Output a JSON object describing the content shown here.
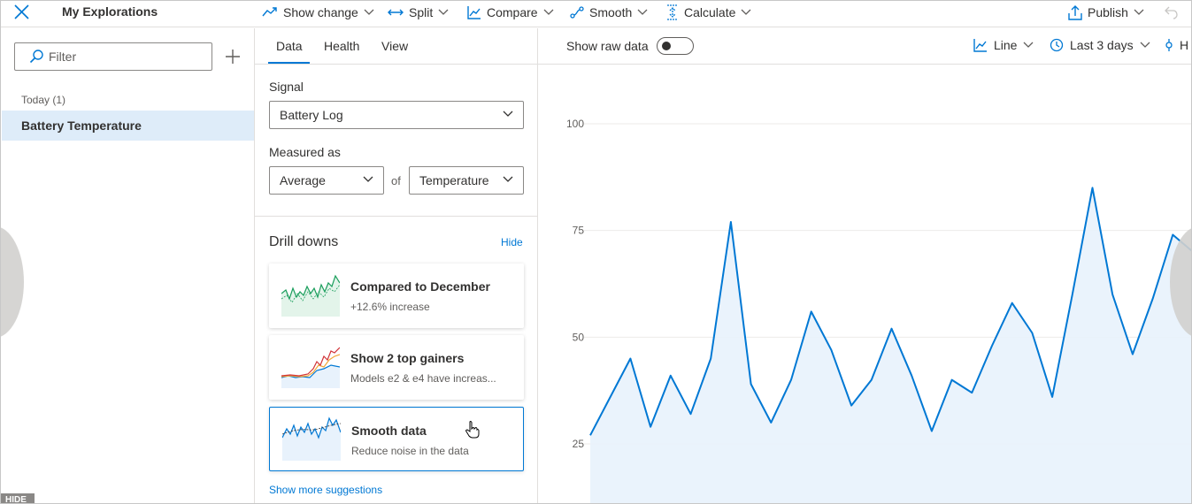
{
  "topbar": {
    "app_title": "My Explorations",
    "items": [
      {
        "label": "Show change",
        "icon": "trend-icon"
      },
      {
        "label": "Split",
        "icon": "split-arrows-icon"
      },
      {
        "label": "Compare",
        "icon": "compare-chart-icon"
      },
      {
        "label": "Smooth",
        "icon": "smooth-icon"
      },
      {
        "label": "Calculate",
        "icon": "calculate-icon"
      }
    ],
    "publish_label": "Publish"
  },
  "leftpane": {
    "filter_placeholder": "Filter",
    "group_label": "Today (1)",
    "items": [
      {
        "label": "Battery Temperature",
        "selected": true
      }
    ],
    "hide_label": "HIDE"
  },
  "midpane": {
    "tabs": [
      {
        "label": "Data",
        "active": true
      },
      {
        "label": "Health",
        "active": false
      },
      {
        "label": "View",
        "active": false
      }
    ],
    "signal_label": "Signal",
    "signal_value": "Battery Log",
    "measured_label": "Measured as",
    "measure_value": "Average",
    "of_label": "of",
    "field_value": "Temperature",
    "drill_title": "Drill downs",
    "hide_link": "Hide",
    "cards": [
      {
        "title": "Compared to December",
        "subtitle": "+12.6% increase",
        "selected": false
      },
      {
        "title": "Show 2 top gainers",
        "subtitle": "Models e2 & e4 have increas...",
        "selected": false
      },
      {
        "title": "Smooth data",
        "subtitle": "Reduce noise in the data",
        "selected": true
      }
    ],
    "more_link": "Show more suggestions"
  },
  "chart_toolbar": {
    "raw_label": "Show raw data",
    "raw_enabled": false,
    "type_label": "Line",
    "range_label": "Last 3 days",
    "cut_label": "H"
  },
  "colors": {
    "accent": "#0078d4",
    "selected_bg": "#deecf9",
    "area_fill": "#e8f2fc"
  },
  "chart_data": {
    "type": "area",
    "title": "",
    "xlabel": "",
    "ylabel": "",
    "ylim": [
      5,
      105
    ],
    "yticks": [
      25,
      50,
      75,
      100
    ],
    "grid": true,
    "legend": "none",
    "series": [
      {
        "values": [
          27,
          36,
          45,
          29,
          41,
          32,
          45,
          77,
          39,
          30,
          40,
          56,
          47,
          34,
          40,
          52,
          41,
          28,
          40,
          37,
          48,
          58,
          51,
          36,
          60,
          85,
          60,
          46,
          59,
          74,
          70
        ]
      }
    ]
  }
}
